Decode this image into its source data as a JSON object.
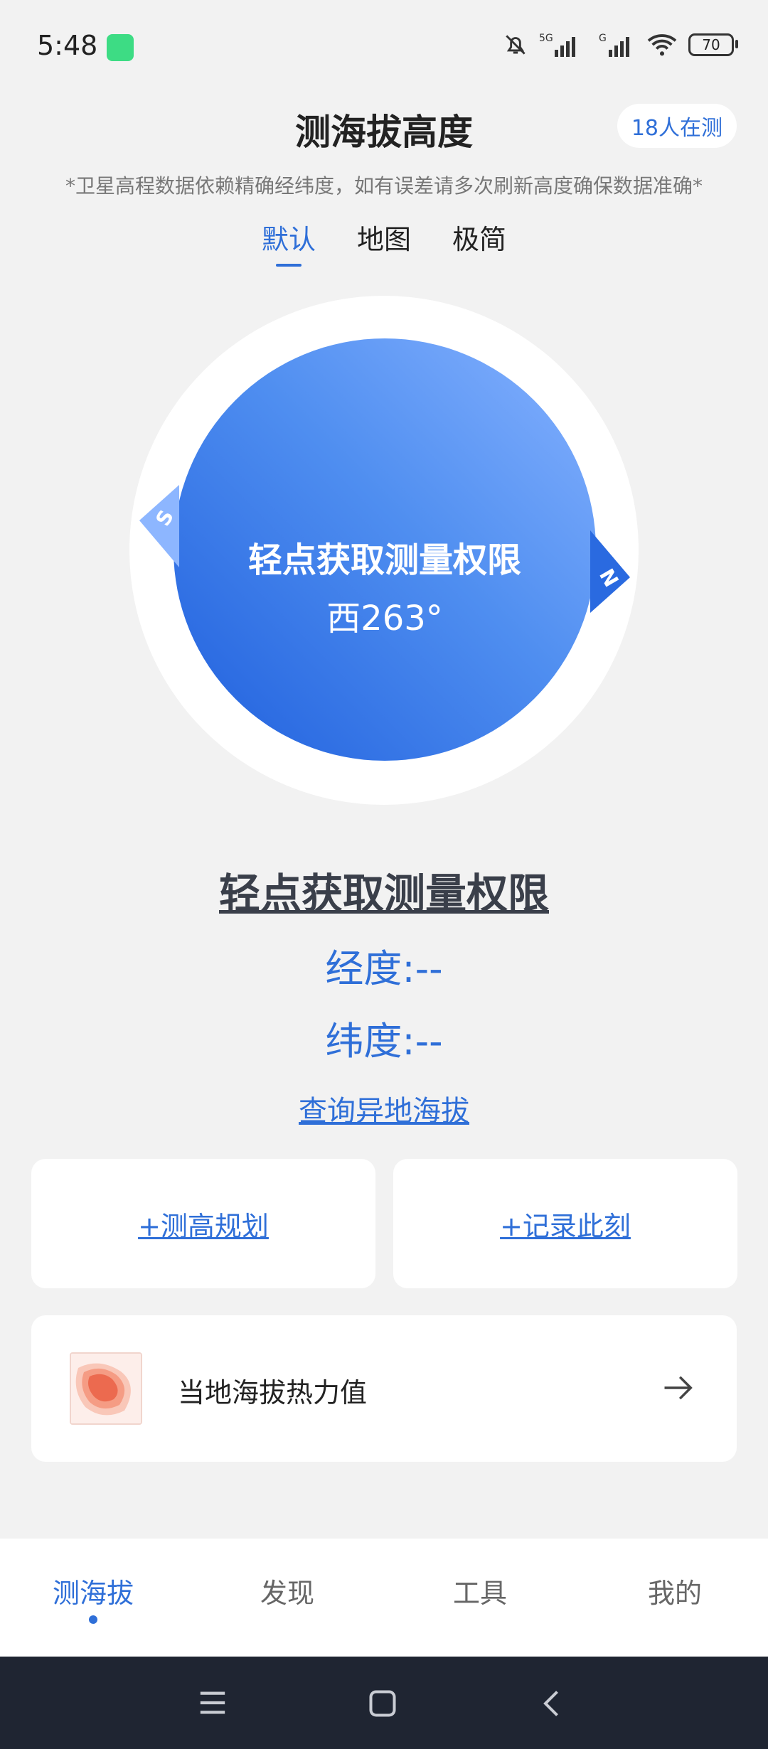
{
  "status": {
    "time": "5:48",
    "network": "5G",
    "battery": "70"
  },
  "header": {
    "title": "测海拔高度",
    "people_testing": "18人在测",
    "notice": "*卫星高程数据依赖精确经纬度，如有误差请多次刷新高度确保数据准确*"
  },
  "mode_tabs": [
    {
      "label": "默认",
      "active": true
    },
    {
      "label": "地图",
      "active": false
    },
    {
      "label": "极简",
      "active": false
    }
  ],
  "compass": {
    "prompt": "轻点获取测量权限",
    "heading": "西263°",
    "south_label": "S",
    "north_label": "N"
  },
  "info": {
    "permission_link": "轻点获取测量权限",
    "longitude": "经度:--",
    "latitude": "纬度:--",
    "query_link": "查询异地海拔"
  },
  "actions": {
    "plan": "+测高规划",
    "record": "+记录此刻"
  },
  "heat_map": {
    "label": "当地海拔热力值"
  },
  "bottom_nav": [
    {
      "label": "测海拔",
      "active": true
    },
    {
      "label": "发现",
      "active": false
    },
    {
      "label": "工具",
      "active": false
    },
    {
      "label": "我的",
      "active": false
    }
  ],
  "colors": {
    "accent": "#2f6fd8",
    "compass_dark": "#1f5fdd",
    "compass_light": "#86b2ff",
    "system_bar": "#1f2532"
  },
  "icons": [
    "android-icon",
    "bell-muted-icon",
    "signal-icon",
    "wifi-icon",
    "battery-icon",
    "arrow-right-icon",
    "menu-icon",
    "home-icon",
    "back-icon"
  ]
}
